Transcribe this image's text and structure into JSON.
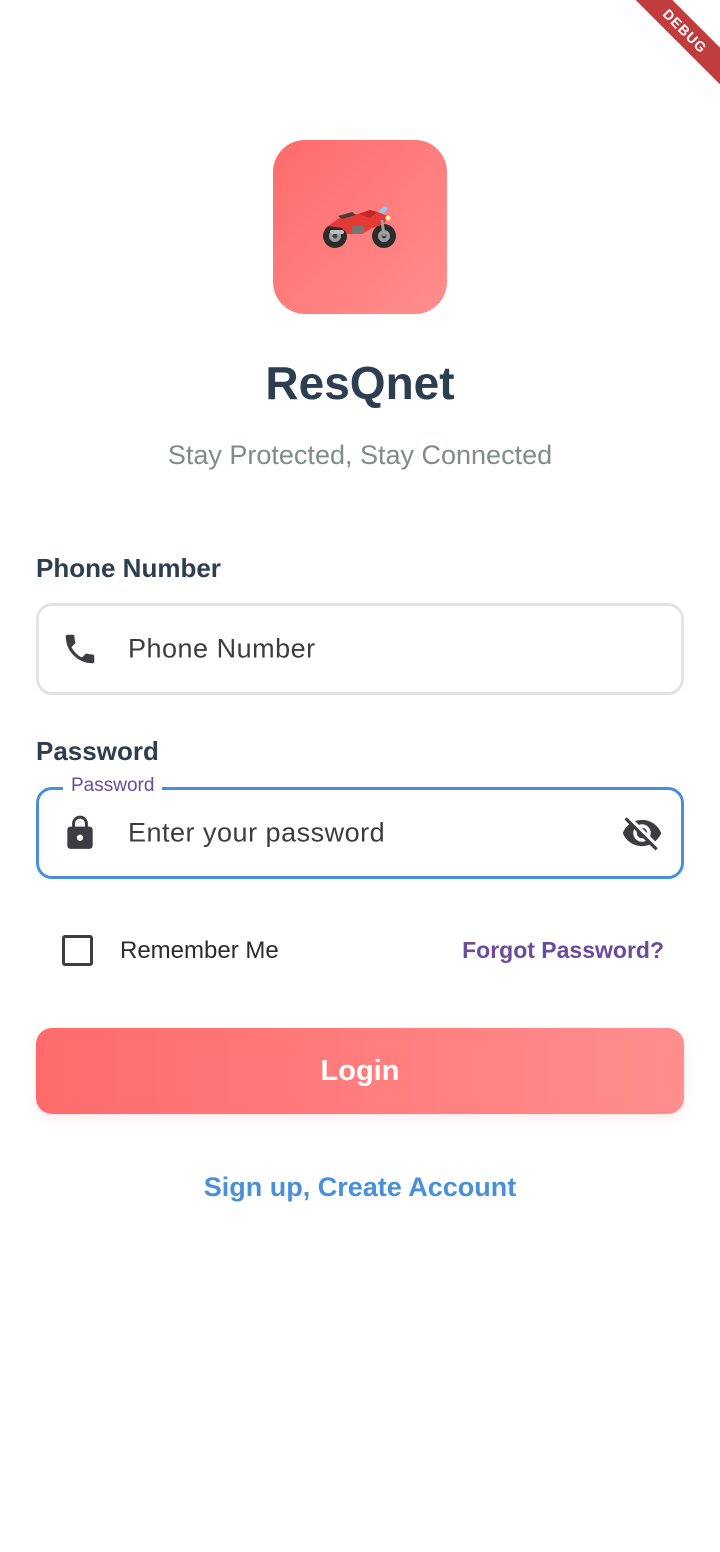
{
  "debug_banner": "DEBUG",
  "logo": {
    "icon": "motorcycle-icon",
    "colors": [
      "#ff6b6b",
      "#ff8e8e"
    ]
  },
  "app": {
    "title": "ResQnet",
    "tagline": "Stay Protected, Stay Connected"
  },
  "phone": {
    "label": "Phone Number",
    "placeholder": "Phone Number",
    "icon": "phone-icon"
  },
  "password": {
    "label": "Password",
    "floating_label": "Password",
    "placeholder": "Enter your password",
    "icon": "lock-icon",
    "toggle_icon": "visibility-off-icon"
  },
  "remember_me": {
    "label": "Remember Me",
    "checked": false
  },
  "forgot_password": "Forgot Password?",
  "login_button": "Login",
  "signup_link": "Sign up, Create Account",
  "colors": {
    "primary": "#ff6b6b",
    "title": "#2c3e50",
    "subtitle": "#7f8c8d",
    "focus_border": "#4a90d9",
    "link_purple": "#6a4c9c",
    "link_blue": "#4a90d9"
  }
}
